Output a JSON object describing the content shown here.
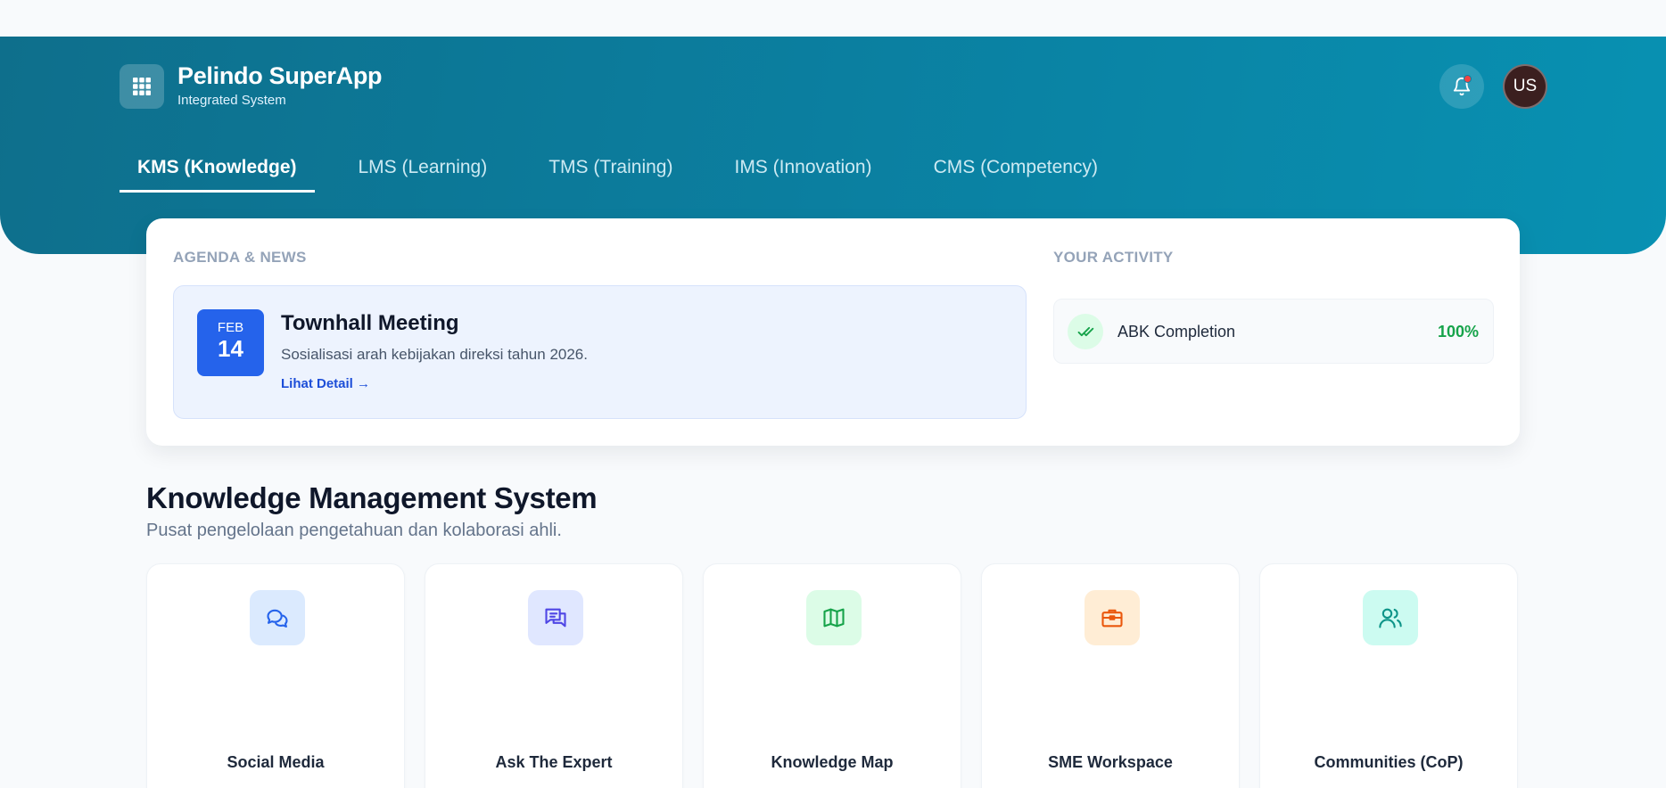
{
  "header": {
    "app_title": "Pelindo SuperApp",
    "app_subtitle": "Integrated System",
    "avatar_initials": "US",
    "notification_dot_color": "#ef4444"
  },
  "tabs": [
    {
      "label": "KMS (Knowledge)",
      "active": true
    },
    {
      "label": "LMS (Learning)",
      "active": false
    },
    {
      "label": "TMS (Training)",
      "active": false
    },
    {
      "label": "IMS (Innovation)",
      "active": false
    },
    {
      "label": "CMS (Competency)",
      "active": false
    }
  ],
  "agenda": {
    "section_label": "AGENDA & NEWS",
    "month": "FEB",
    "day": "14",
    "title": "Townhall Meeting",
    "description": "Sosialisasi arah kebijakan direksi tahun 2026.",
    "link_label": "Lihat Detail →"
  },
  "activity": {
    "section_label": "YOUR ACTIVITY",
    "items": [
      {
        "label": "ABK Completion",
        "value": "100%",
        "icon": "double-check-icon"
      }
    ]
  },
  "kms": {
    "title": "Knowledge Management System",
    "subtitle": "Pusat pengelolaan pengetahuan dan kolaborasi ahli.",
    "modules": [
      {
        "label": "Social Media",
        "icon": "chat-bubbles-icon",
        "bg": "#dbeafe",
        "fg": "#2563eb"
      },
      {
        "label": "Ask The Expert",
        "icon": "message-square-icon",
        "bg": "#e0e7ff",
        "fg": "#4f46e5"
      },
      {
        "label": "Knowledge Map",
        "icon": "map-icon",
        "bg": "#dcfce7",
        "fg": "#16a34a"
      },
      {
        "label": "SME Workspace",
        "icon": "briefcase-icon",
        "bg": "#ffedd5",
        "fg": "#ea580c"
      },
      {
        "label": "Communities (CoP)",
        "icon": "users-icon",
        "bg": "#ccfbf1",
        "fg": "#0d9488"
      }
    ]
  },
  "colors": {
    "brand": "#0b7fa0",
    "accent_blue": "#2563eb",
    "success": "#16a34a"
  }
}
